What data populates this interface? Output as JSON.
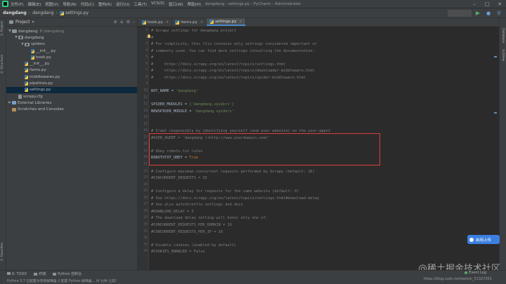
{
  "window": {
    "title": "dangdang - settings.py - PyCharm - Administrator",
    "menu": [
      "文件(F)",
      "编辑(E)",
      "视图(V)",
      "导航(N)",
      "代码(C)",
      "重构(R)",
      "运行(U)",
      "工具(T)",
      "VCS(S)",
      "窗口(W)",
      "帮助(H)"
    ]
  },
  "breadcrumb": {
    "project": "dangdang",
    "module": "dangdang",
    "file": "settings.py"
  },
  "project_panel": {
    "title": "Project",
    "rows": [
      {
        "label": "dangdang",
        "path": "E:\\dangdang",
        "kind": "folder"
      },
      {
        "label": "dangdang",
        "path": "",
        "kind": "pkg"
      },
      {
        "label": "spiders",
        "path": "",
        "kind": "pkg"
      },
      {
        "label": "__init__.py",
        "path": "",
        "kind": "py"
      },
      {
        "label": "book.py",
        "path": "",
        "kind": "py"
      },
      {
        "label": "__init__.py",
        "path": "",
        "kind": "py"
      },
      {
        "label": "items.py",
        "path": "",
        "kind": "py"
      },
      {
        "label": "middlewares.py",
        "path": "",
        "kind": "py"
      },
      {
        "label": "pipelines.py",
        "path": "",
        "kind": "py"
      },
      {
        "label": "settings.py",
        "path": "",
        "kind": "py"
      },
      {
        "label": "scrapy.cfg",
        "path": "",
        "kind": "cfg"
      },
      {
        "label": "External Libraries",
        "path": "",
        "kind": "lib"
      },
      {
        "label": "Scratches and Consoles",
        "path": "",
        "kind": "scr"
      }
    ]
  },
  "editor": {
    "tabs": [
      "book.py",
      "items.py",
      "settings.py"
    ],
    "active_tab": "settings.py",
    "lines": [
      {
        "n": "1",
        "t": "# Scrapy settings for dangdang project"
      },
      {
        "n": "2",
        "t": "#"
      },
      {
        "n": "3",
        "t": "# For simplicity, this file contains only settings considered important or"
      },
      {
        "n": "4",
        "t": "# commonly used. You can find more settings consulting the documentation:"
      },
      {
        "n": "5",
        "t": "#"
      },
      {
        "n": "6",
        "t": "#     https://docs.scrapy.org/en/latest/topics/settings.html"
      },
      {
        "n": "7",
        "t": "#     https://docs.scrapy.org/en/latest/topics/downloader-middleware.html"
      },
      {
        "n": "8",
        "t": "#     https://docs.scrapy.org/en/latest/topics/spider-middleware.html"
      },
      {
        "n": "9",
        "t": ""
      },
      {
        "n": "10",
        "k": "BOT_NAME = ",
        "v": "'dangdang'"
      },
      {
        "n": "11",
        "t": ""
      },
      {
        "n": "12",
        "k": "SPIDER_MODULES = ",
        "v": "['dangdang.spiders']"
      },
      {
        "n": "13",
        "k": "NEWSPIDER_MODULE = ",
        "v": "'dangdang.spiders'"
      },
      {
        "n": "14",
        "t": ""
      },
      {
        "n": "15",
        "t": ""
      },
      {
        "n": "16",
        "t": "# Crawl responsibly by identifying yourself (and your website) on the user-agent"
      },
      {
        "n": "17",
        "t": "#USER_AGENT = 'dangdang (+http://www.yourdomain.com)'"
      },
      {
        "n": "18",
        "t": ""
      },
      {
        "n": "19",
        "t": "# Obey robots.txt rules"
      },
      {
        "n": "20",
        "k": "ROBOTSTXT_OBEY = ",
        "v": "True"
      },
      {
        "n": "21",
        "t": ""
      },
      {
        "n": "22",
        "t": "# Configure maximum concurrent requests performed by Scrapy (default: 16)"
      },
      {
        "n": "23",
        "t": "#CONCURRENT_REQUESTS = 32"
      },
      {
        "n": "24",
        "t": ""
      },
      {
        "n": "25",
        "t": "# Configure a delay for requests for the same website (default: 0)"
      },
      {
        "n": "26",
        "t": "# See https://docs.scrapy.org/en/latest/topics/settings.html#download-delay"
      },
      {
        "n": "27",
        "t": "# See also autothrottle settings and docs"
      },
      {
        "n": "28",
        "t": "#DOWNLOAD_DELAY = 3"
      },
      {
        "n": "29",
        "t": "# The download delay setting will honor only one of:"
      },
      {
        "n": "30",
        "t": "#CONCURRENT_REQUESTS_PER_DOMAIN = 16"
      },
      {
        "n": "31",
        "t": "#CONCURRENT_REQUESTS_PER_IP = 16"
      },
      {
        "n": "32",
        "t": ""
      },
      {
        "n": "33",
        "t": "# Disable cookies (enabled by default)"
      },
      {
        "n": "34",
        "t": "#COOKIES_ENABLED = False"
      }
    ]
  },
  "left_tool_tabs": [
    "1: Project",
    "2: Structure",
    "2: Favorites"
  ],
  "right_tool_tabs": [
    "Database",
    "SciView"
  ],
  "bottom_tabs": [
    "6: TODO",
    "终端",
    "Python 控制台"
  ],
  "event_log": "Event Log",
  "status_text": "Python 3.7 已配置为项目解释器 // 配置 Python 解释器... (4 分钟 之前)",
  "float_button": "启用上传",
  "watermark": "@稀土掘金技术社区",
  "watermark_sub": "https://blog.csdn.net/weixin_51327051",
  "colors": {
    "accent": "#4a88c7",
    "highlight_box": "#e23b3b",
    "selection": "#0d293e"
  }
}
